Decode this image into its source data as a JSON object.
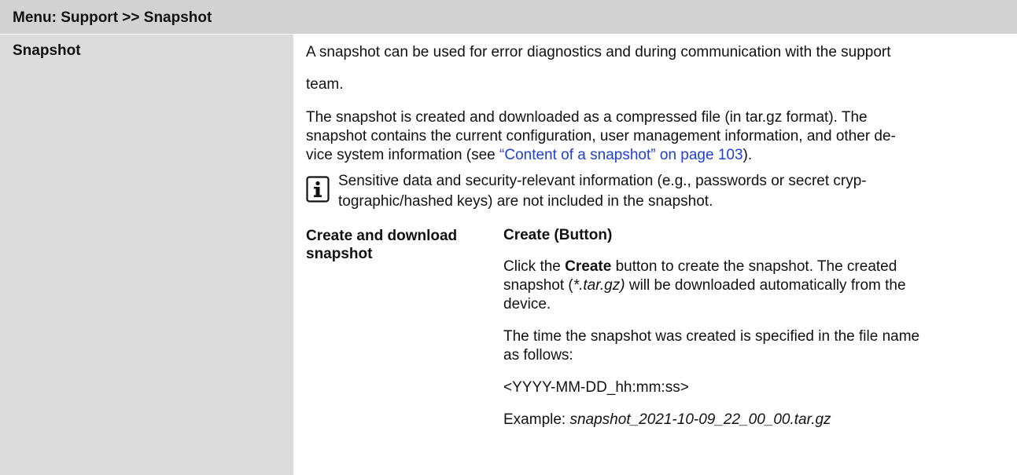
{
  "header": {
    "title": "Menu: Support >> Snapshot"
  },
  "section": {
    "title": "Snapshot",
    "intro_line1": "A snapshot can be used for error diagnostics and during communication with the support",
    "intro_line2": "team.",
    "desc_line1": "The snapshot is created and downloaded as a compressed file (in tar.gz format). The",
    "desc_line2": "snapshot contains the current configuration, user management information, and other de-",
    "desc_line3_pre": "vice system information (see ",
    "desc_link": "“Content of a snapshot” on page 103",
    "desc_line3_post": ").",
    "note_icon": "info-icon",
    "note_line1": "Sensitive data and security-relevant information (e.g., passwords or secret cryp-",
    "note_line2": "tographic/hashed keys) are not included in the snapshot."
  },
  "subsection": {
    "label_line1": "Create and download",
    "label_line2": "snapshot",
    "button_heading": "Create (Button)",
    "click_pre": "Click the ",
    "click_bold": "Create",
    "click_post": " button to create the snapshot. The created",
    "snap_pre": "snapshot (",
    "snap_italic": "*.tar.gz)",
    "snap_post": " will be downloaded automatically from the",
    "device_line": "device.",
    "time_line1": "The time the snapshot was created is specified in the file name",
    "time_line2": "as follows:",
    "format": "<YYYY-MM-DD_hh:mm:ss>",
    "example_label": "Example: ",
    "example_value": "snapshot_2021-10-09_22_00_00.tar.gz"
  }
}
